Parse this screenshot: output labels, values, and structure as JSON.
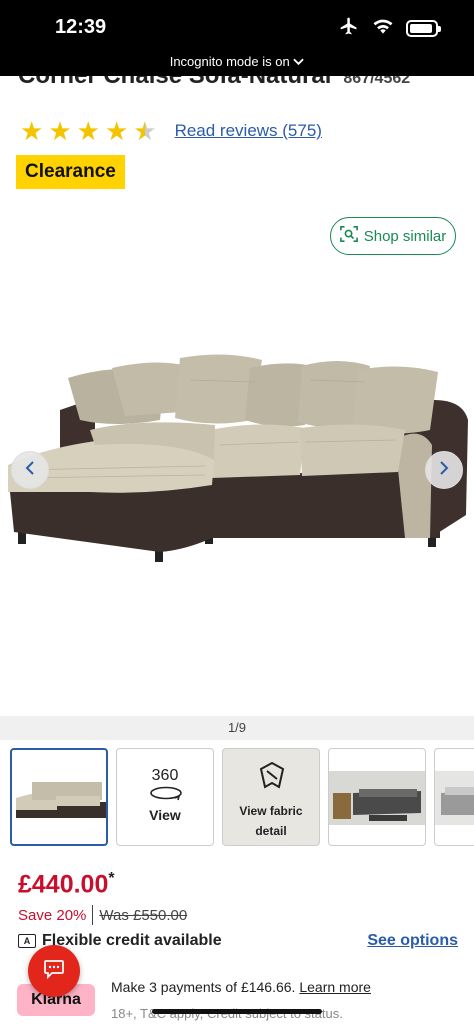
{
  "status_bar": {
    "time": "12:39",
    "incognito_label": "Incognito mode is on",
    "icons": [
      "airplane-icon",
      "wifi-icon",
      "battery-icon"
    ]
  },
  "product": {
    "title": "Corner Chaise Sofa-Natural",
    "code": "867/4562",
    "rating": 4.5,
    "reviews_link": "Read reviews (575)",
    "badge": "Clearance"
  },
  "shop_similar_label": "Shop similar",
  "gallery": {
    "counter": "1/9",
    "thumbnails": [
      {
        "type": "image",
        "label": ""
      },
      {
        "type": "360",
        "title": "360",
        "label": "View"
      },
      {
        "type": "fabric",
        "label": "View fabric detail"
      },
      {
        "type": "image",
        "label": ""
      },
      {
        "type": "image",
        "label": ""
      }
    ]
  },
  "pricing": {
    "price": "£440.00",
    "asterisk": "*",
    "save": "Save 20%",
    "was": "Was £550.00"
  },
  "credit": {
    "label": "Flexible credit available",
    "link": "See options"
  },
  "klarna": {
    "badge": "Klarna",
    "text": "Make 3 payments of £146.66.",
    "link": "Learn more",
    "terms": "18+, T&C apply, Credit subject to status."
  },
  "colors": {
    "accent_blue": "#2b5ca8",
    "sale_red": "#c8102e",
    "clearance_yellow": "#ffd200",
    "shop_green": "#1a8a55",
    "klarna_pink": "#ffb3c7"
  }
}
